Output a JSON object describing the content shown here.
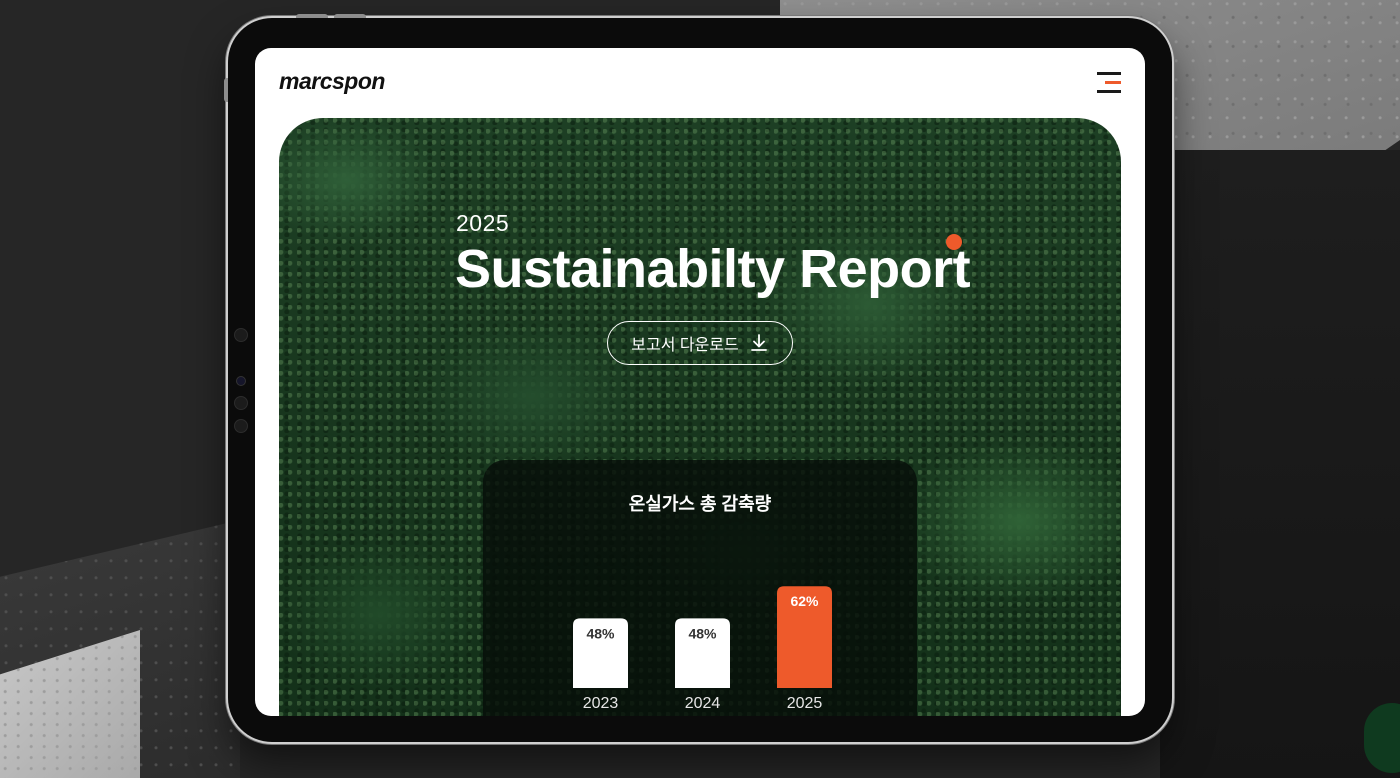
{
  "app": {
    "logo": "marcspon",
    "menu_icon": "hamburger-menu-icon",
    "accent_color": "#ee5a2b"
  },
  "hero": {
    "year": "2025",
    "title": "Sustainabilty Report",
    "download_label": "보고서 다운로드",
    "download_icon": "download-arrow-icon"
  },
  "chart_data": {
    "type": "bar",
    "title": "온실가스 총 감축량",
    "categories": [
      "2023",
      "2024",
      "2025"
    ],
    "values": [
      48,
      48,
      62
    ],
    "value_labels": [
      "48%",
      "48%",
      "62%"
    ],
    "ylim": [
      0,
      100
    ],
    "colors": [
      "#ffffff",
      "#ffffff",
      "#ee5a2b"
    ],
    "label_colors": [
      "#333333",
      "#333333",
      "#ffffff"
    ],
    "xlabel": "",
    "ylabel": ""
  }
}
